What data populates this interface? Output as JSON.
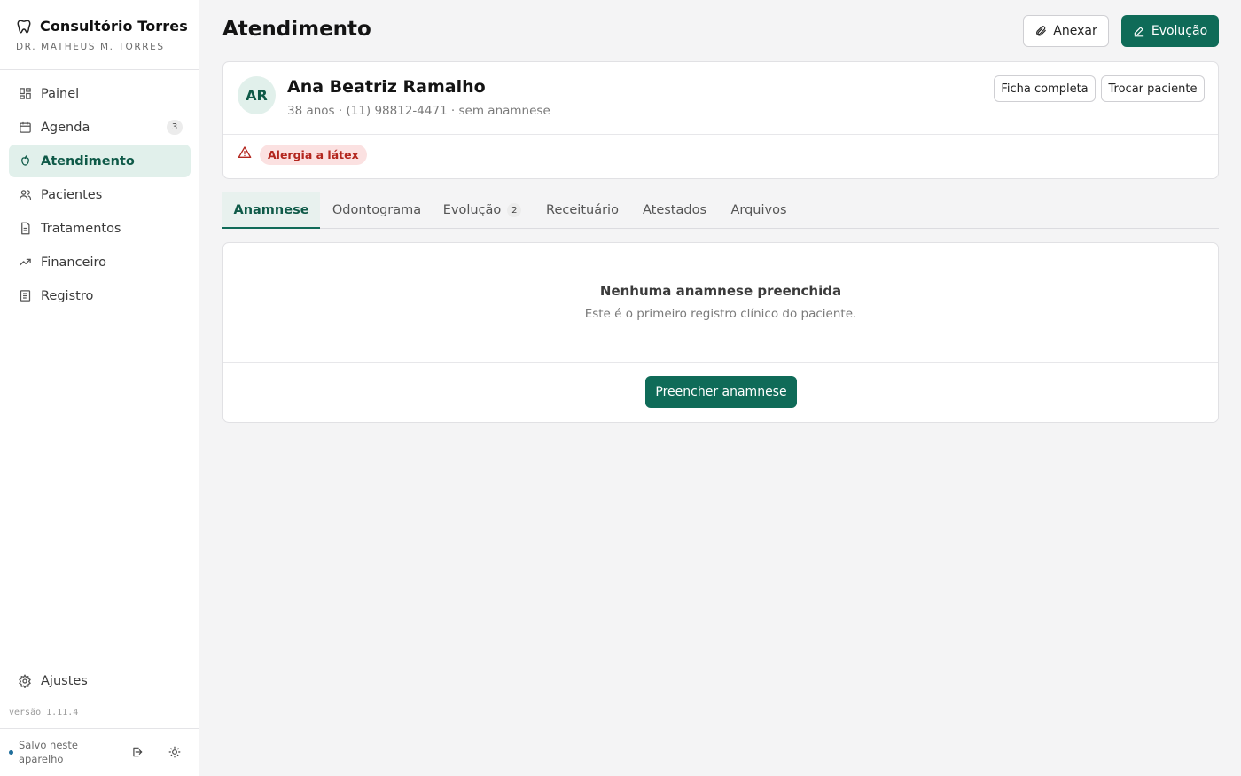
{
  "brand": {
    "title": "Consultório Torres",
    "subtitle": "DR. MATHEUS M. TORRES",
    "icon": "tooth-icon"
  },
  "nav": {
    "items": [
      {
        "label": "Painel",
        "icon": "dashboard-icon"
      },
      {
        "label": "Agenda",
        "icon": "calendar-icon",
        "badge": "3"
      },
      {
        "label": "Atendimento",
        "icon": "apple-icon",
        "active": true
      },
      {
        "label": "Pacientes",
        "icon": "users-icon"
      },
      {
        "label": "Tratamentos",
        "icon": "document-icon"
      },
      {
        "label": "Financeiro",
        "icon": "trend-icon"
      },
      {
        "label": "Registro",
        "icon": "list-icon"
      }
    ]
  },
  "sidebar_footer": {
    "settings_label": "Ajustes",
    "version": "versão 1.11.4",
    "saved_status": "Salvo neste aparelho",
    "status_color": "#1f6e9b"
  },
  "header": {
    "title": "Atendimento",
    "attach_label": "Anexar",
    "evolution_label": "Evolução"
  },
  "patient": {
    "initials": "AR",
    "name": "Ana Beatriz Ramalho",
    "meta": "38 anos · (11) 98812-4471 · sem anamnese",
    "full_record_label": "Ficha completa",
    "switch_label": "Trocar paciente",
    "allergy": "Alergia a látex"
  },
  "tabs": [
    {
      "label": "Anamnese",
      "active": true
    },
    {
      "label": "Odontograma"
    },
    {
      "label": "Evolução",
      "badge": "2"
    },
    {
      "label": "Receituário"
    },
    {
      "label": "Atestados"
    },
    {
      "label": "Arquivos"
    }
  ],
  "anamnese": {
    "empty_title": "Nenhuma anamnese preenchida",
    "empty_subtitle": "Este é o primeiro registro clínico do paciente.",
    "fill_label": "Preencher anamnese"
  },
  "colors": {
    "accent": "#0f6b58",
    "accent_light": "#e1f0eb",
    "danger": "#b3261e",
    "danger_bg": "#fbe1e1"
  }
}
